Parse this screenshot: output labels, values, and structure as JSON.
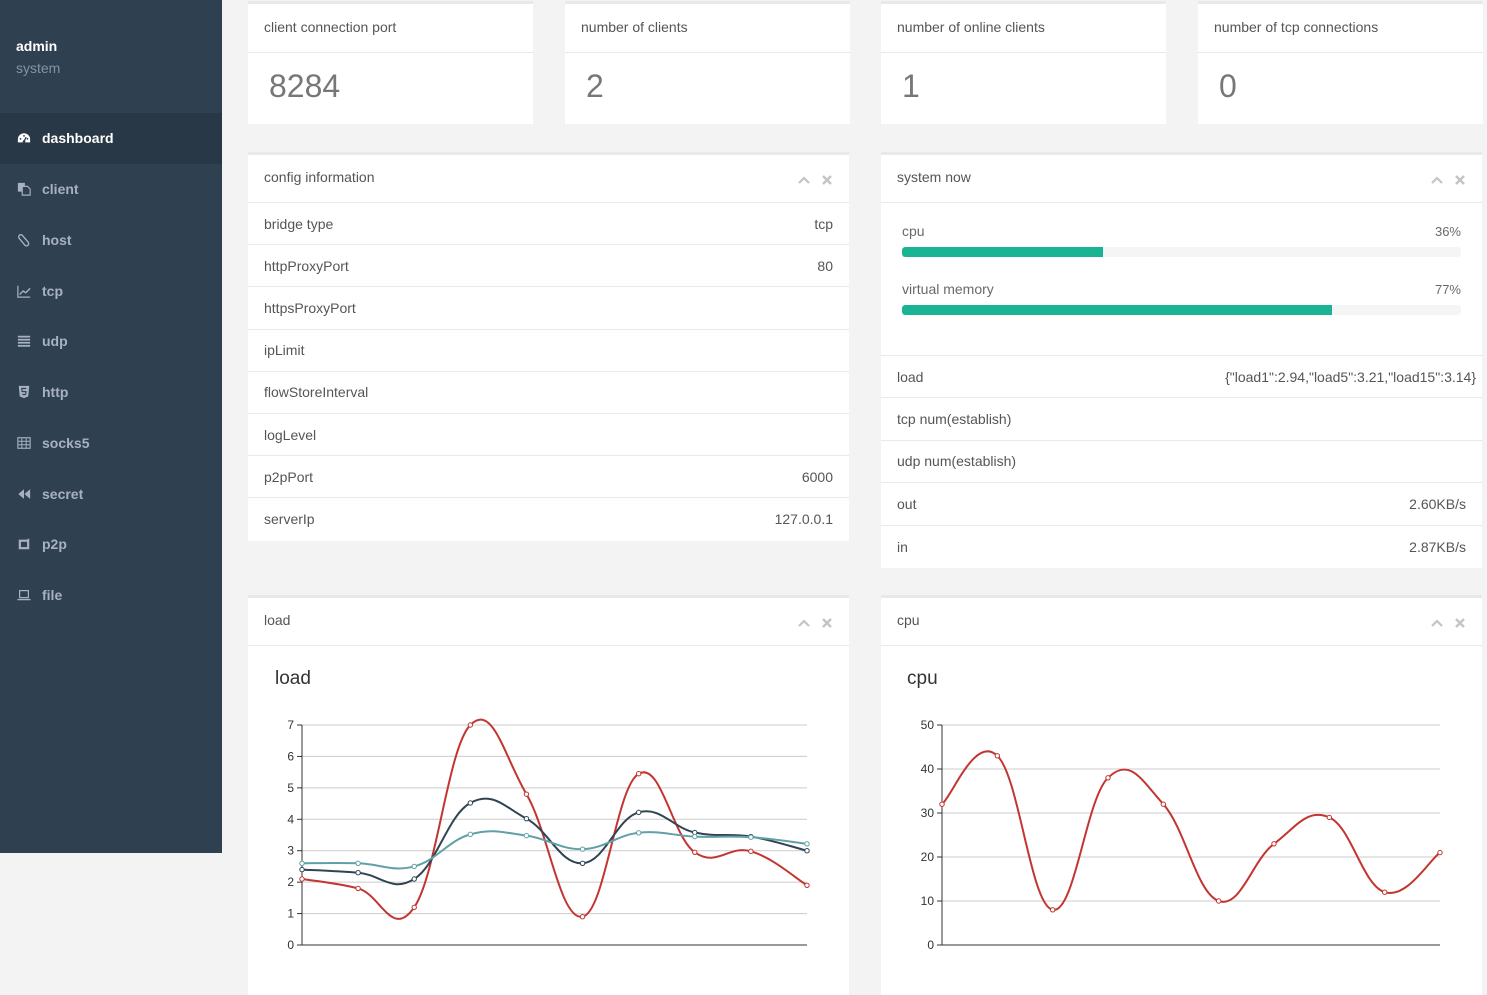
{
  "sidebar": {
    "user": {
      "name": "admin",
      "role": "system"
    },
    "items": [
      {
        "label": "dashboard",
        "icon": "dashboard-icon",
        "active": true
      },
      {
        "label": "client",
        "icon": "files-icon",
        "active": false
      },
      {
        "label": "host",
        "icon": "paperclip-icon",
        "active": false
      },
      {
        "label": "tcp",
        "icon": "line-chart-icon",
        "active": false
      },
      {
        "label": "udp",
        "icon": "server-list-icon",
        "active": false
      },
      {
        "label": "http",
        "icon": "html5-icon",
        "active": false
      },
      {
        "label": "socks5",
        "icon": "table-icon",
        "active": false
      },
      {
        "label": "secret",
        "icon": "backward-icon",
        "active": false
      },
      {
        "label": "p2p",
        "icon": "tablet-icon",
        "active": false
      },
      {
        "label": "file",
        "icon": "laptop-icon",
        "active": false
      }
    ]
  },
  "stats": [
    {
      "title": "client connection port",
      "value": "8284"
    },
    {
      "title": "number of clients",
      "value": "2"
    },
    {
      "title": "number of online clients",
      "value": "1"
    },
    {
      "title": "number of tcp connections",
      "value": "0"
    }
  ],
  "config": {
    "title": "config information",
    "rows": [
      {
        "label": "bridge type",
        "value": "tcp"
      },
      {
        "label": "httpProxyPort",
        "value": "80"
      },
      {
        "label": "httpsProxyPort",
        "value": ""
      },
      {
        "label": "ipLimit",
        "value": ""
      },
      {
        "label": "flowStoreInterval",
        "value": ""
      },
      {
        "label": "logLevel",
        "value": ""
      },
      {
        "label": "p2pPort",
        "value": "6000"
      },
      {
        "label": "serverIp",
        "value": "127.0.0.1"
      }
    ]
  },
  "system": {
    "title": "system now",
    "progress": [
      {
        "label": "cpu",
        "percent": 36,
        "text": "36%"
      },
      {
        "label": "virtual memory",
        "percent": 77,
        "text": "77%"
      }
    ],
    "rows": [
      {
        "label": "load",
        "value": "{\"load1\":2.94,\"load5\":3.21,\"load15\":3.14}"
      },
      {
        "label": "tcp num(establish)",
        "value": ""
      },
      {
        "label": "udp num(establish)",
        "value": ""
      },
      {
        "label": "out",
        "value": "2.60KB/s"
      },
      {
        "label": "in",
        "value": "2.87KB/s"
      }
    ]
  },
  "panels": {
    "load": {
      "title": "load"
    },
    "cpu": {
      "title": "cpu"
    }
  },
  "colors": {
    "sidebar_bg": "#2f4050",
    "sidebar_active": "#293846",
    "progress": "#1ab394",
    "series_red": "#c23531",
    "series_dark": "#2f4554",
    "series_teal": "#61a0a8"
  },
  "chart_data": [
    {
      "type": "line",
      "title": "load",
      "xlabel": "",
      "ylabel": "",
      "ylim": [
        0,
        7
      ],
      "ytick": 1,
      "grid": true,
      "smooth": true,
      "series": [
        {
          "name": "",
          "color": "#c23531",
          "values": [
            2.1,
            1.8,
            1.2,
            7.0,
            4.8,
            0.9,
            5.45,
            2.95,
            2.98,
            1.9
          ]
        },
        {
          "name": "",
          "color": "#2f4554",
          "values": [
            2.4,
            2.3,
            2.1,
            4.52,
            4.02,
            2.6,
            4.22,
            3.58,
            3.45,
            3.0
          ]
        },
        {
          "name": "",
          "color": "#61a0a8",
          "values": [
            2.6,
            2.6,
            2.5,
            3.52,
            3.48,
            3.05,
            3.57,
            3.45,
            3.43,
            3.22
          ]
        }
      ]
    },
    {
      "type": "line",
      "title": "cpu",
      "xlabel": "",
      "ylabel": "",
      "ylim": [
        0,
        50
      ],
      "ytick": 10,
      "grid": true,
      "smooth": true,
      "series": [
        {
          "name": "",
          "color": "#c23531",
          "values": [
            32,
            43,
            8,
            38,
            32,
            10,
            23,
            29,
            12,
            21
          ]
        }
      ]
    }
  ]
}
